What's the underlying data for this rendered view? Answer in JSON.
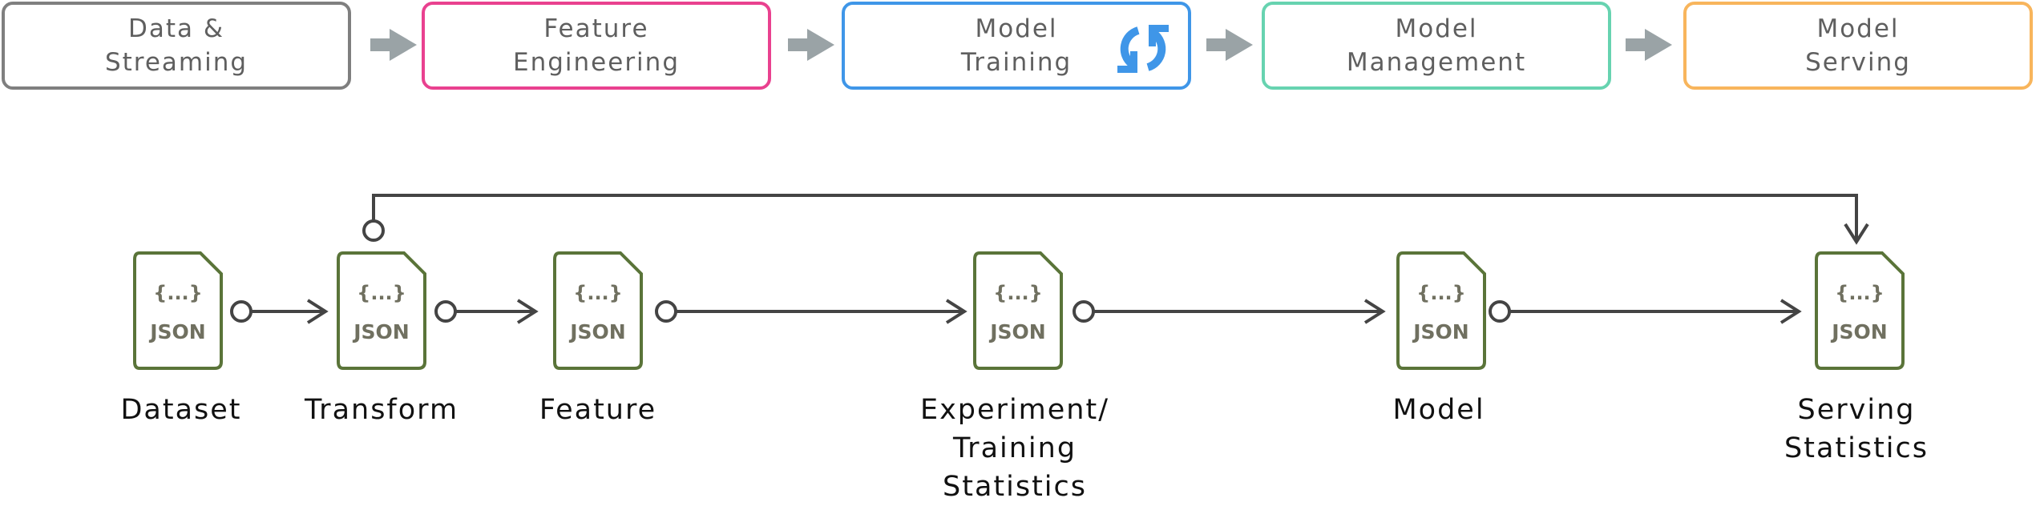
{
  "stages": [
    {
      "line1": "Data &",
      "line2": "Streaming",
      "color": "#7f7f7f"
    },
    {
      "line1": "Feature",
      "line2": "Engineering",
      "color": "#e9418f"
    },
    {
      "line1": "Model",
      "line2": "Training",
      "color": "#3f96e8",
      "icon": "refresh-icon"
    },
    {
      "line1": "Model",
      "line2": "Management",
      "color": "#67d3b0"
    },
    {
      "line1": "Model",
      "line2": "Serving",
      "color": "#f8b55c"
    }
  ],
  "stage_arrow_color": "#9aa3a6",
  "artifact_icon": {
    "brace": "{...}",
    "type": "JSON",
    "border_color": "#5a7439",
    "text_color": "#707060"
  },
  "artifacts": [
    {
      "label_lines": [
        "Dataset"
      ]
    },
    {
      "label_lines": [
        "Transform"
      ]
    },
    {
      "label_lines": [
        "Feature"
      ]
    },
    {
      "label_lines": [
        "Experiment/",
        "Training",
        "Statistics"
      ]
    },
    {
      "label_lines": [
        "Model"
      ]
    },
    {
      "label_lines": [
        "Serving",
        "Statistics"
      ]
    }
  ],
  "connector_color": "#444444"
}
